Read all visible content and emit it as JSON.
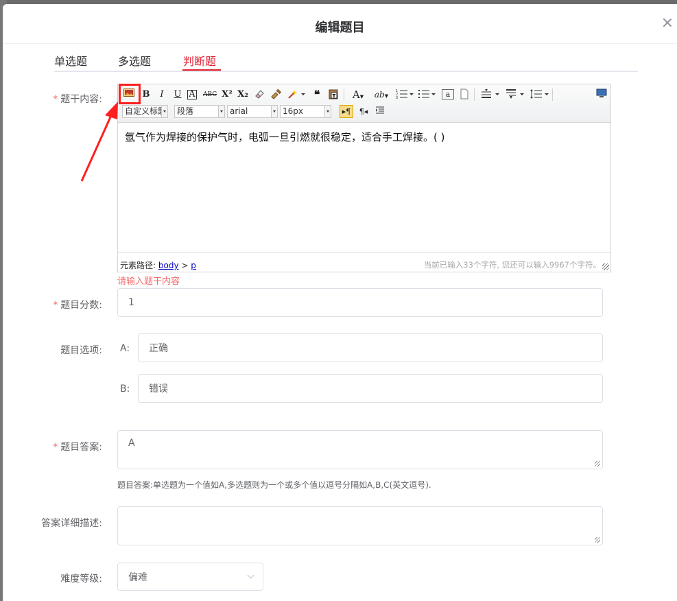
{
  "dialog": {
    "title": "编辑题目"
  },
  "tabs": [
    {
      "label": "单选题",
      "active": false
    },
    {
      "label": "多选题",
      "active": false
    },
    {
      "label": "判断题",
      "active": true
    }
  ],
  "form": {
    "stem_label": "题干内容:",
    "score_label": "题目分数:",
    "options_label": "题目选项:",
    "answer_label": "题目答案:",
    "detail_label": "答案详细描述:",
    "difficulty_label": "难度等级:"
  },
  "editor": {
    "toolbar_selects": {
      "heading": "自定义标题",
      "paragraph": "段落",
      "font": "arial",
      "size": "16px"
    },
    "content": "氩气作为焊接的保护气时，电弧一旦引燃就很稳定，适合手工焊接。( )",
    "path_label": "元素路径:",
    "path_body": "body",
    "path_sep": ">",
    "path_p": "p",
    "char_count": "当前已输入33个字符, 您还可以输入9967个字符。"
  },
  "validation_error": "请输入题干内容",
  "score_value": "1",
  "options": [
    {
      "key": "A:",
      "value": "正确"
    },
    {
      "key": "B:",
      "value": "错误"
    }
  ],
  "answer_value": "A",
  "answer_hint": "题目答案:单选题为一个值如A,多选题则为一个或多个值以逗号分隔如A,B,C(英文逗号).",
  "detail_value": "",
  "difficulty_value": "偏难",
  "colors": {
    "accent": "#e01e2f",
    "error": "#f56c6c",
    "highlight": "#ff1f1f"
  }
}
